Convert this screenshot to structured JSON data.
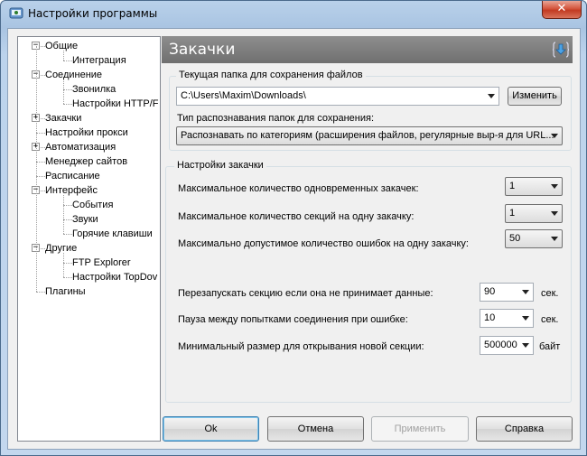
{
  "window": {
    "title": "Настройки программы",
    "close_glyph": "✕"
  },
  "tree": {
    "items": [
      {
        "label": "Общие",
        "level": 0,
        "expander": "−"
      },
      {
        "label": "Интеграция",
        "level": 1
      },
      {
        "label": "Соединение",
        "level": 0,
        "expander": "−"
      },
      {
        "label": "Звонилка",
        "level": 1
      },
      {
        "label": "Настройки HTTP/F",
        "level": 1
      },
      {
        "label": "Закачки",
        "level": 0,
        "expander": "+"
      },
      {
        "label": "Настройки прокси",
        "level": 0
      },
      {
        "label": "Автоматизация",
        "level": 0,
        "expander": "+"
      },
      {
        "label": "Менеджер сайтов",
        "level": 0
      },
      {
        "label": "Расписание",
        "level": 0
      },
      {
        "label": "Интерфейс",
        "level": 0,
        "expander": "−"
      },
      {
        "label": "События",
        "level": 1
      },
      {
        "label": "Звуки",
        "level": 1
      },
      {
        "label": "Горячие клавиши",
        "level": 1
      },
      {
        "label": "Другие",
        "level": 0,
        "expander": "−"
      },
      {
        "label": "FTP Explorer",
        "level": 1
      },
      {
        "label": "Настройки TopDov",
        "level": 1
      },
      {
        "label": "Плагины",
        "level": 0
      }
    ]
  },
  "header": {
    "title": "Закачки",
    "icon": "download-arrow-icon"
  },
  "folder_group": {
    "title": "Текущая папка для сохранения файлов",
    "folder_value": "C:\\Users\\Maxim\\Downloads\\",
    "change_button": "Изменить",
    "recognition_label": "Тип распознавания папок для сохранения:",
    "recognition_value": "Распознавать по категориям (расширения файлов, регулярные выр-я для URL..."
  },
  "download_group": {
    "title": "Настройки закачки",
    "rows": [
      {
        "label": "Максимальное количество одновременных закачек:",
        "value": "1",
        "unit": ""
      },
      {
        "label": "Максимальное количество секций на одну закачку:",
        "value": "1",
        "unit": ""
      },
      {
        "label": "Максимально допустимое количество ошибок на одну закачку:",
        "value": "50",
        "unit": ""
      },
      {
        "label": "Перезапускать секцию если она не принимает данные:",
        "value": "90",
        "unit": "сек."
      },
      {
        "label": "Пауза между попытками соединения при ошибке:",
        "value": "10",
        "unit": "сек."
      },
      {
        "label": "Минимальный размер для открывания новой секции:",
        "value": "500000",
        "unit": "байт"
      }
    ]
  },
  "buttons": {
    "ok": "Ok",
    "cancel": "Отмена",
    "apply": "Применить",
    "help": "Справка"
  },
  "colors": {
    "header_bg": "#7a7a7a",
    "window_frame": "#b9d1ea",
    "close_button": "#c9452c",
    "default_button_border": "#3c7fb1"
  }
}
